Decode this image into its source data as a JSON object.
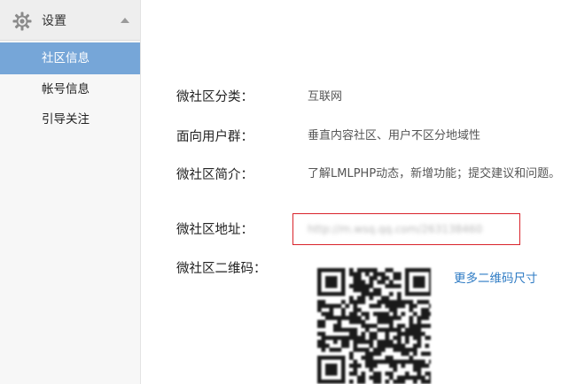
{
  "sidebar": {
    "header": {
      "title": "设置",
      "icon": "gear-icon",
      "collapse_icon": "triangle-up-icon"
    },
    "items": [
      {
        "label": "社区信息",
        "active": true
      },
      {
        "label": "帐号信息",
        "active": false
      },
      {
        "label": "引导关注",
        "active": false
      }
    ]
  },
  "main": {
    "fields": [
      {
        "label": "微社区分类：",
        "value": "互联网"
      },
      {
        "label": "面向用户群：",
        "value": "垂直内容社区、用户不区分地域性"
      },
      {
        "label": "微社区简介：",
        "value": "了解LMLPHP动态，新增功能；提交建议和问题。"
      },
      {
        "label": "微社区地址：",
        "value": "http://m.wsq.qq.com/263138460"
      },
      {
        "label": "微社区二维码："
      }
    ],
    "more_qr_link": "更多二维码尺寸"
  },
  "colors": {
    "active_nav": "#76a6d8",
    "link": "#2e7bc4",
    "url_border": "#d9232b"
  }
}
